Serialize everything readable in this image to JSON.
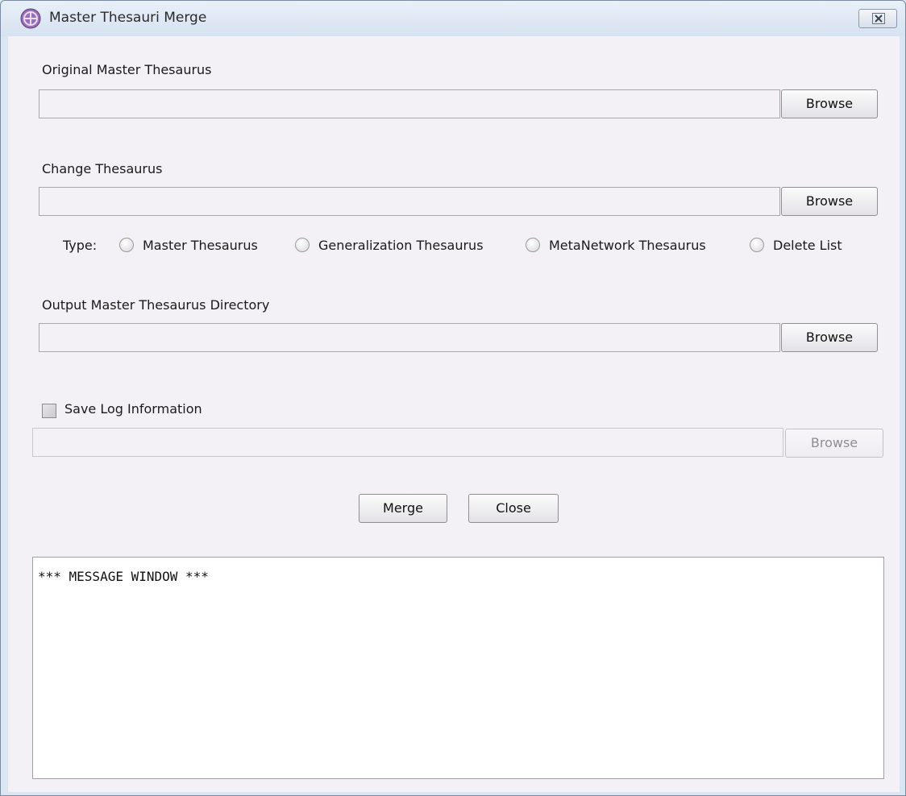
{
  "window": {
    "title": "Master Thesauri Merge"
  },
  "original": {
    "label": "Original Master Thesaurus",
    "value": "",
    "browse_label": "Browse"
  },
  "change": {
    "label": "Change Thesaurus",
    "value": "",
    "browse_label": "Browse",
    "type_label": "Type:",
    "types": [
      {
        "label": "Master Thesaurus",
        "selected": false
      },
      {
        "label": "Generalization Thesaurus",
        "selected": false
      },
      {
        "label": "MetaNetwork Thesaurus",
        "selected": false
      },
      {
        "label": "Delete List",
        "selected": false
      }
    ]
  },
  "output": {
    "label": "Output Master Thesaurus Directory",
    "value": "",
    "browse_label": "Browse"
  },
  "log": {
    "checkbox_label": "Save Log Information",
    "checked": false,
    "value": "",
    "browse_label": "Browse",
    "browse_enabled": false
  },
  "actions": {
    "merge_label": "Merge",
    "close_label": "Close"
  },
  "message_window": {
    "text": "*** MESSAGE WINDOW ***"
  },
  "icons": {
    "app": "app-logo-icon",
    "close": "close-x-icon"
  }
}
